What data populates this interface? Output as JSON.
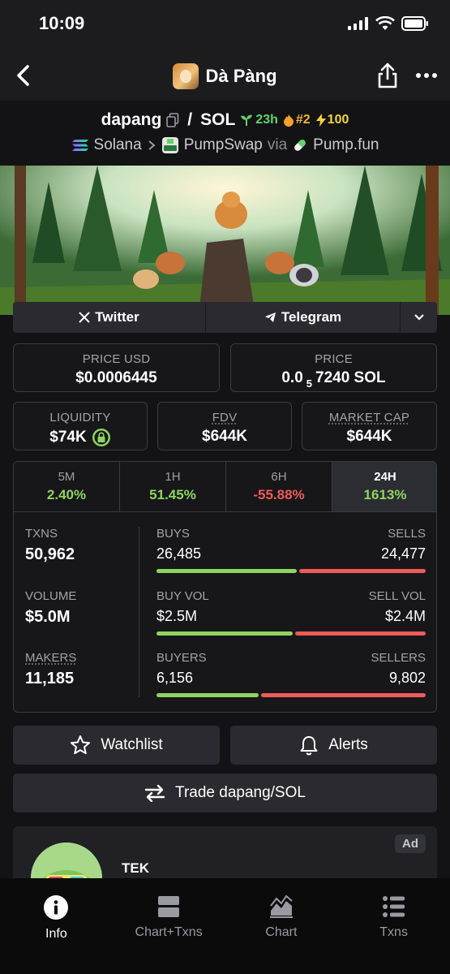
{
  "status": {
    "time": "10:09"
  },
  "nav": {
    "title": "Dà Pàng"
  },
  "pair": {
    "base": "dapang",
    "quote": "SOL",
    "separator": "/",
    "age": "23h",
    "rank": "#2",
    "boosts": "100",
    "chain": "Solana",
    "dex": "PumpSwap",
    "via_label": "via",
    "launchpad": "Pump.fun"
  },
  "socials": {
    "twitter": "Twitter",
    "telegram": "Telegram"
  },
  "price_usd": {
    "label": "PRICE USD",
    "value": "$0.0006445"
  },
  "price_native": {
    "label": "PRICE",
    "prefix": "0.0",
    "zeros": "5",
    "digits": "7240 SOL"
  },
  "liquidity": {
    "label": "LIQUIDITY",
    "value": "$74K"
  },
  "fdv": {
    "label": "FDV",
    "value": "$644K"
  },
  "market_cap": {
    "label": "MARKET CAP",
    "value": "$644K"
  },
  "timeframes": [
    {
      "label": "5M",
      "change": "2.40%"
    },
    {
      "label": "1H",
      "change": "51.45%"
    },
    {
      "label": "6H",
      "change": "-55.88%"
    },
    {
      "label": "24H",
      "change": "1613%"
    }
  ],
  "metrics": {
    "txns": {
      "label": "TXNS",
      "value": "50,962"
    },
    "volume": {
      "label": "VOLUME",
      "value": "$5.0M"
    },
    "makers": {
      "label": "MAKERS",
      "value": "11,185"
    }
  },
  "splits": {
    "buys": {
      "label": "BUYS",
      "value": "26,485"
    },
    "sells": {
      "label": "SELLS",
      "value": "24,477"
    },
    "buy_vol": {
      "label": "BUY VOL",
      "value": "$2.5M"
    },
    "sell_vol": {
      "label": "SELL VOL",
      "value": "$2.4M"
    },
    "buyers": {
      "label": "BUYERS",
      "value": "6,156"
    },
    "sellers": {
      "label": "SELLERS",
      "value": "9,802"
    }
  },
  "actions": {
    "watchlist": "Watchlist",
    "alerts": "Alerts",
    "trade": "Trade dapang/SOL"
  },
  "ad": {
    "badge": "Ad",
    "name": "TEK"
  },
  "tabs": [
    {
      "label": "Info",
      "icon": "info-icon"
    },
    {
      "label": "Chart+Txns",
      "icon": "split-view-icon"
    },
    {
      "label": "Chart",
      "icon": "area-chart-icon"
    },
    {
      "label": "Txns",
      "icon": "list-icon"
    }
  ],
  "colors": {
    "positive": "#8fd460",
    "negative": "#ef5a5a",
    "background": "#131316"
  }
}
